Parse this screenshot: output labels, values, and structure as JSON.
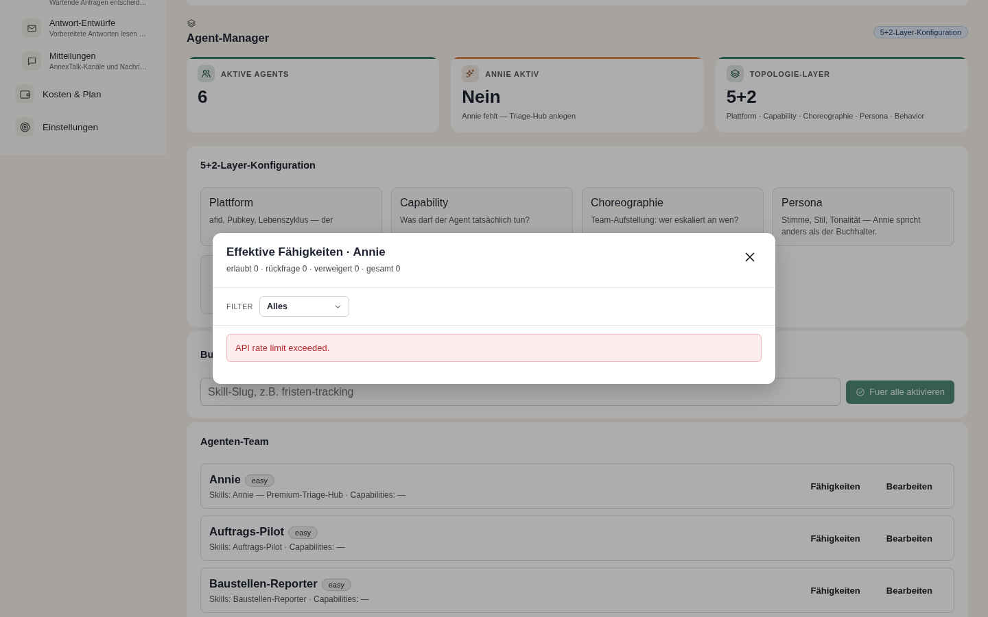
{
  "sidebar": {
    "items": [
      {
        "kind": "cut",
        "subtitle": "Wartende Anfragen entscheid…"
      },
      {
        "kind": "sub",
        "title": "Antwort-Entwürfe",
        "subtitle": "Vorbereitete Antworten lesen …"
      },
      {
        "kind": "sub",
        "title": "Mitteilungen",
        "subtitle": "AnnexTalk-Kanäle und Nachri…"
      },
      {
        "kind": "main",
        "title": "Kosten & Plan"
      },
      {
        "kind": "main",
        "title": "Einstellungen"
      }
    ]
  },
  "header": {
    "title": "Agent-Manager",
    "badge": "5+2-Layer-Konfiguration"
  },
  "stats": [
    {
      "label": "AKTIVE AGENTS",
      "value": "6",
      "color": "#205343"
    },
    {
      "label": "ANNIE AKTIV",
      "value": "Nein",
      "note": "Annie fehlt — Triage-Hub anlegen",
      "color": "#985c35"
    },
    {
      "label": "TOPOLOGIE-LAYER",
      "value": "5+2",
      "note": "Plattform · Capability · Choreographie · Persona · Behavior",
      "color": "#205343"
    }
  ],
  "layers": {
    "title": "5+2-Layer-Konfiguration",
    "cards": [
      {
        "title": "Plattform",
        "text": "afid, Pubkey, Lebenszyklus — der"
      },
      {
        "title": "Capability",
        "text": "Was darf der Agent tatsächlich tun?"
      },
      {
        "title": "Choreographie",
        "text": "Team-Aufstellung: wer eskaliert an wen?"
      },
      {
        "title": "Persona",
        "text": "Stimme, Stil, Tonalität — Annie spricht anders als der Buchhalter."
      }
    ]
  },
  "bulk": {
    "title": "Bu",
    "placeholder": "Skill-Slug, z.B. fristen-tracking",
    "button": "Fuer alle aktivieren"
  },
  "team": {
    "title": "Agenten-Team",
    "agents": [
      {
        "name": "Annie",
        "tag": "easy",
        "skills": "Skills: Annie — Premium-Triage-Hub · Capabilities: —",
        "actions": [
          "Fähigkeiten",
          "Bearbeiten"
        ]
      },
      {
        "name": "Auftrags-Pilot",
        "tag": "easy",
        "skills": "Skills: Auftrags-Pilot · Capabilities: —",
        "actions": [
          "Fähigkeiten",
          "Bearbeiten"
        ]
      },
      {
        "name": "Baustellen-Reporter",
        "tag": "easy",
        "skills": "Skills: Baustellen-Reporter · Capabilities: —",
        "actions": [
          "Fähigkeiten",
          "Bearbeiten"
        ]
      }
    ]
  },
  "modal": {
    "title": "Effektive Fähigkeiten · Annie",
    "summary": "erlaubt 0 · rückfrage 0 · verweigert 0 · gesamt 0",
    "filter_label": "FILTER",
    "filter_value": "Alles",
    "error": "API rate limit exceeded."
  }
}
